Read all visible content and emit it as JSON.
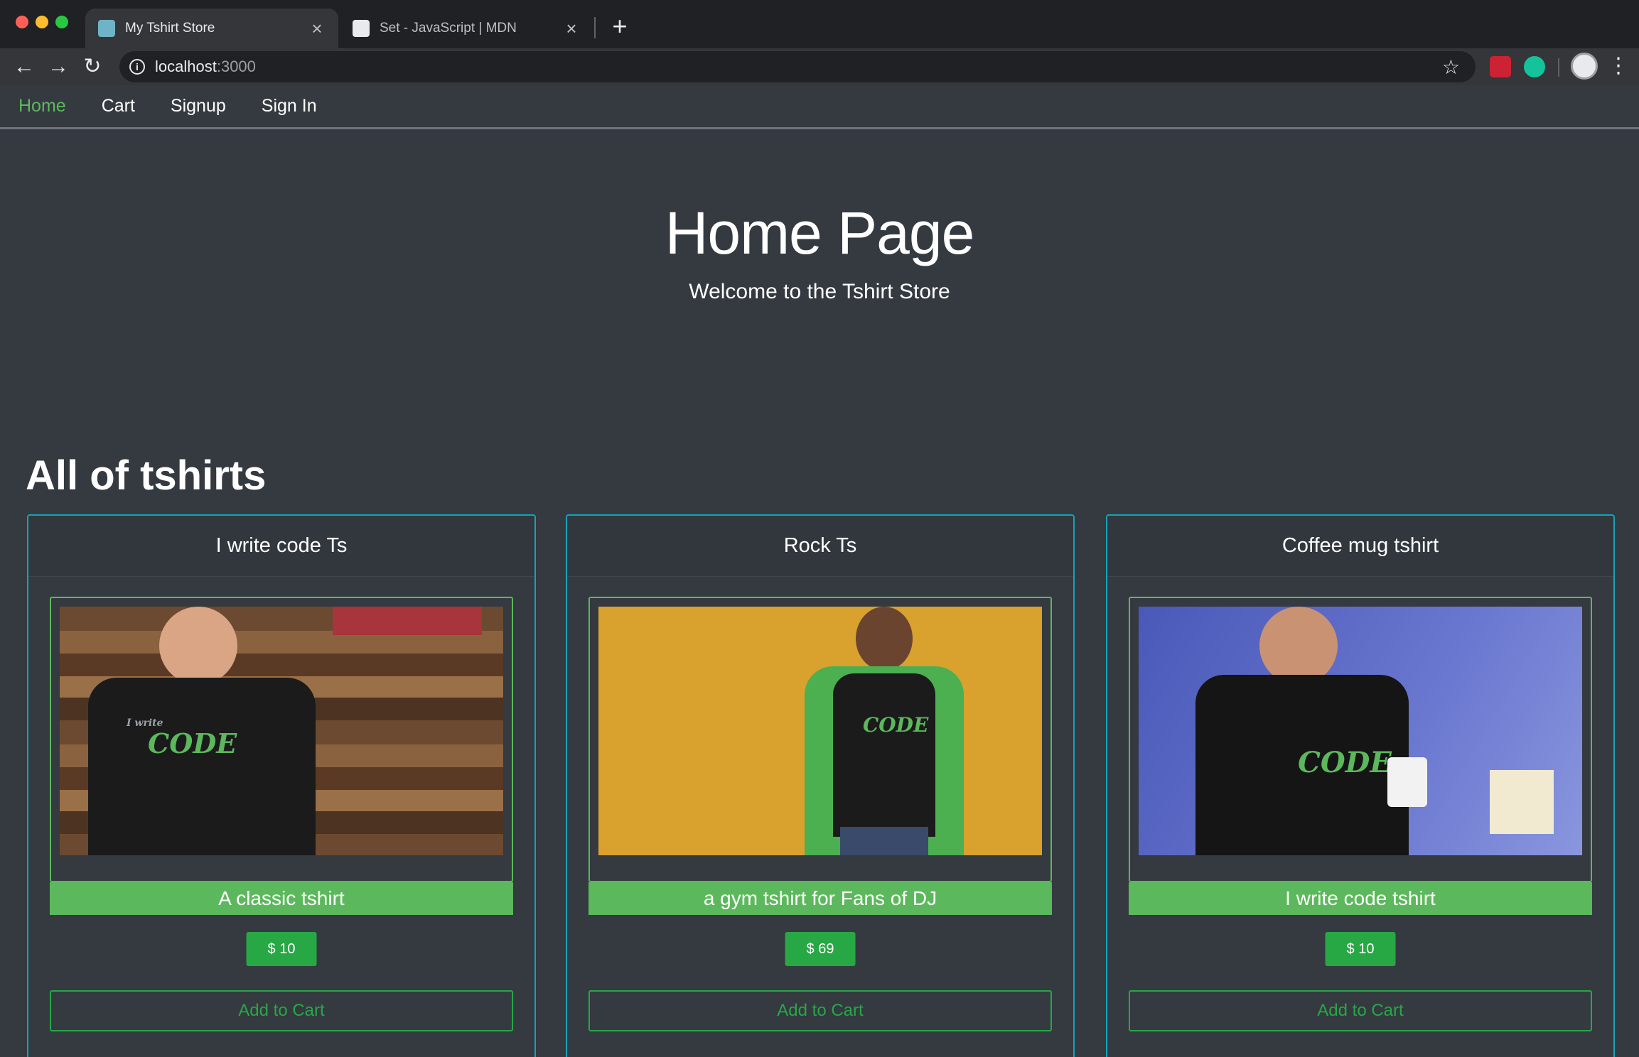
{
  "browser": {
    "tabs": [
      {
        "title": "My Tshirt Store",
        "active": true
      },
      {
        "title": "Set - JavaScript | MDN",
        "active": false
      }
    ],
    "url_host": "localhost",
    "url_port": ":3000"
  },
  "nav": {
    "items": [
      "Home",
      "Cart",
      "Signup",
      "Sign In"
    ],
    "active": "Home"
  },
  "hero": {
    "title": "Home Page",
    "subtitle": "Welcome to the Tshirt Store"
  },
  "section_title": "All of tshirts",
  "products": [
    {
      "name": "I write code Ts",
      "description": "A classic tshirt",
      "price": "$ 10",
      "button": "Add to Cart",
      "image": "man-black-code-tshirt-wood-wall"
    },
    {
      "name": "Rock Ts",
      "description": "a gym tshirt for Fans of DJ",
      "price": "$ 69",
      "button": "Add to Cart",
      "image": "man-raglan-code-tshirt-yellow-wall"
    },
    {
      "name": "Coffee mug tshirt",
      "description": "I write code tshirt",
      "price": "$ 10",
      "button": "Add to Cart",
      "image": "man-code-tshirt-holding-mug"
    }
  ],
  "photo_logo": {
    "small": "I write",
    "big": "CODE"
  },
  "colors": {
    "accent": "#5cb85c",
    "success": "#28a745",
    "card_border": "#17a2b8",
    "background": "#343a40"
  }
}
